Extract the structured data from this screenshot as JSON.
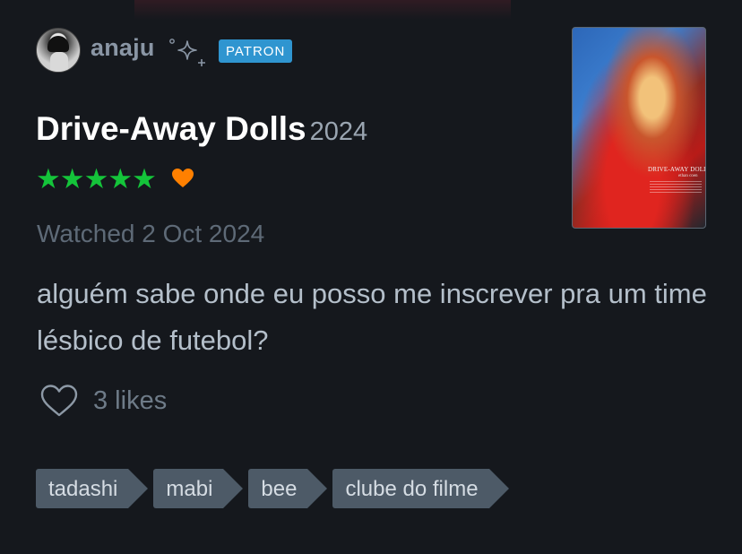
{
  "user": {
    "name": "anaju",
    "badge": "PATRON",
    "avatar_icon": "user-avatar"
  },
  "film": {
    "title": "Drive-Away Dolls",
    "year": "2024",
    "poster_title": "DRIVE-AWAY DOLLS",
    "poster_subtitle": "ethan coen"
  },
  "rating": {
    "stars": "★★★★★",
    "value": 5,
    "max": 5,
    "liked": true,
    "star_color": "#14c43a",
    "heart_color": "#ff8000"
  },
  "entry": {
    "watched": "Watched 2 Oct 2024",
    "review": "alguém sabe onde eu posso me inscrever pra um time lésbico de futebol?"
  },
  "likes": {
    "count_label": "3 likes"
  },
  "tags": [
    "tadashi",
    "mabi",
    "bee",
    "clube do filme"
  ],
  "colors": {
    "background": "#15181d",
    "patron_badge": "#2f95d0",
    "tag_bg": "#4d5a67"
  }
}
